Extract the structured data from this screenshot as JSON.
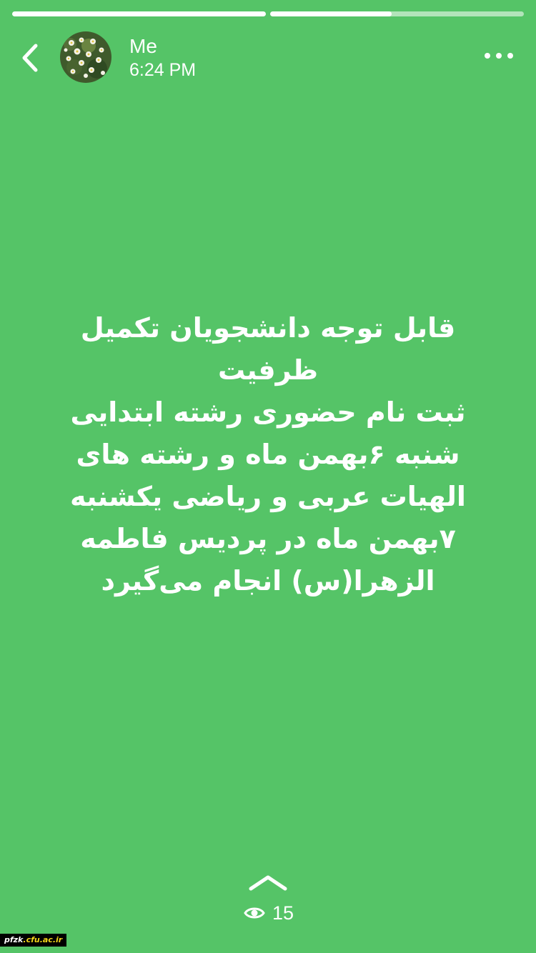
{
  "story": {
    "progress": [
      {
        "fraction": 1.0
      },
      {
        "fraction": 0.48
      }
    ],
    "author": {
      "name": "Me",
      "time": "6:24 PM"
    },
    "text_lines": [
      "قابل توجه دانشجویان تکمیل",
      "ظرفیت",
      "ثبت نام حضوری  رشته ابتدایی",
      "شنبه ۶بهمن ماه و رشته های",
      "الهیات عربی و ریاضی یکشنبه",
      "۷بهمن ماه در پردیس فاطمه",
      "الزهرا(س) انجام می‌گیرد"
    ],
    "views": "15",
    "background_color": "#55c467"
  },
  "icons": {
    "back": "chevron-left-icon",
    "more": "ellipsis-icon",
    "swipe": "chevron-up-icon",
    "views": "eye-icon"
  },
  "watermark": {
    "prefix": "pfzk",
    "accent": ".cfu.ac.ir"
  }
}
